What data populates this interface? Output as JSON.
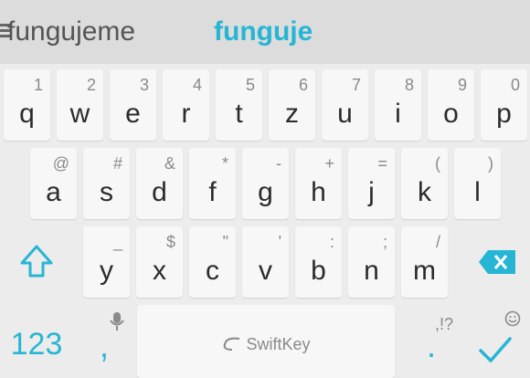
{
  "suggestions": {
    "left": "fungujeme",
    "center": "funguje"
  },
  "rows": [
    [
      {
        "main": "q",
        "sec": "1"
      },
      {
        "main": "w",
        "sec": "2"
      },
      {
        "main": "e",
        "sec": "3"
      },
      {
        "main": "r",
        "sec": "4"
      },
      {
        "main": "t",
        "sec": "5"
      },
      {
        "main": "z",
        "sec": "6"
      },
      {
        "main": "u",
        "sec": "7"
      },
      {
        "main": "i",
        "sec": "8"
      },
      {
        "main": "o",
        "sec": "9"
      },
      {
        "main": "p",
        "sec": "0"
      }
    ],
    [
      {
        "main": "a",
        "sec": "@"
      },
      {
        "main": "s",
        "sec": "#"
      },
      {
        "main": "d",
        "sec": "&"
      },
      {
        "main": "f",
        "sec": "*"
      },
      {
        "main": "g",
        "sec": "-"
      },
      {
        "main": "h",
        "sec": "+"
      },
      {
        "main": "j",
        "sec": "="
      },
      {
        "main": "k",
        "sec": "("
      },
      {
        "main": "l",
        "sec": ")"
      }
    ],
    [
      {
        "main": "y",
        "sec": "_"
      },
      {
        "main": "x",
        "sec": "$"
      },
      {
        "main": "c",
        "sec": "\""
      },
      {
        "main": "v",
        "sec": "'"
      },
      {
        "main": "b",
        "sec": ":"
      },
      {
        "main": "n",
        "sec": ";"
      },
      {
        "main": "m",
        "sec": "/"
      }
    ]
  ],
  "bottom": {
    "numbers": "123",
    "comma": ",",
    "space_brand": "SwiftKey",
    "period": ".",
    "period_sec": ",!?"
  },
  "colors": {
    "accent": "#26b6d4",
    "key": "#f7f7f7",
    "bg": "#ececec",
    "suggestion_bg": "#dcdcdc"
  },
  "icons": {
    "shift": "shift-icon",
    "backspace": "backspace-icon",
    "mic": "microphone-icon",
    "emoji": "emoji-icon",
    "enter": "checkmark-icon",
    "menu": "menu-icon"
  }
}
